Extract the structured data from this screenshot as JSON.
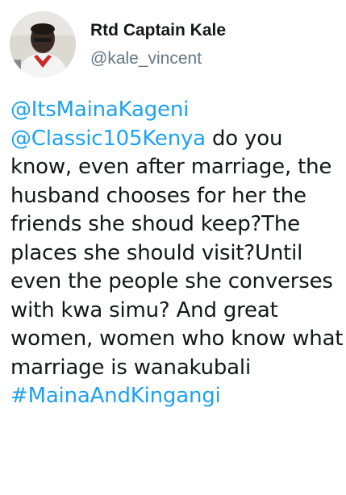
{
  "tweet": {
    "author": {
      "display_name": "Rtd Captain Kale",
      "handle": "@kale_vincent",
      "avatar_icon": "profile-photo"
    },
    "mentions": [
      "@ItsMainaKageni",
      "@Classic105Kenya"
    ],
    "text": " do you know, even after marriage, the husband chooses for her the friends she shoud keep?The places she should visit?Until even the people she converses with kwa simu? And great women, women who know what marriage is wanakubali ",
    "hashtag": "#MainaAndKingangi"
  },
  "colors": {
    "link": "#1da1f2",
    "text": "#14171a",
    "secondary": "#657786"
  }
}
